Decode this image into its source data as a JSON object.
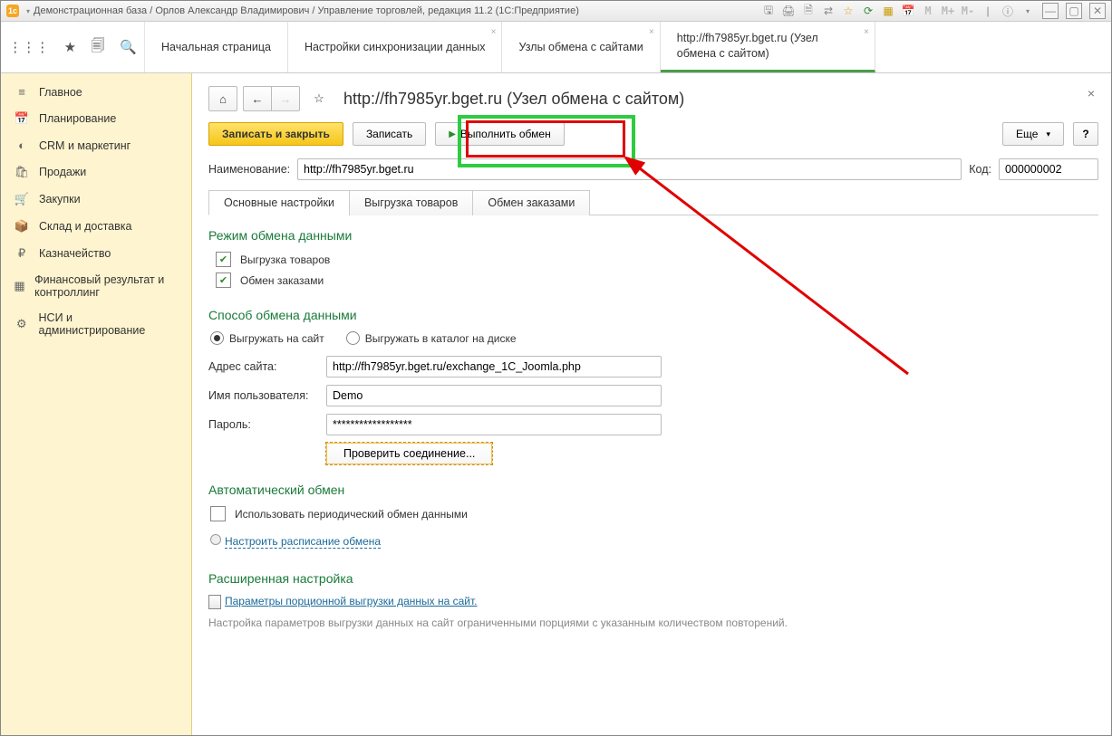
{
  "titlebar": {
    "logo_text": "1c",
    "title": "Демонстрационная база / Орлов Александр Владимирович / Управление торговлей, редакция 11.2  (1С:Предприятие)"
  },
  "tb_icons": {
    "m1": "M",
    "m2": "M+",
    "m3": "M-",
    "info": "ⓘ"
  },
  "tabs": [
    {
      "label": "Начальная страница",
      "active": false,
      "closable": false
    },
    {
      "label": "Настройки синхронизации данных",
      "active": false,
      "closable": true
    },
    {
      "label": "Узлы обмена с сайтами",
      "active": false,
      "closable": true
    },
    {
      "label": "http://fh7985yr.bget.ru (Узел обмена с сайтом)",
      "active": true,
      "closable": true
    }
  ],
  "sidebar": [
    {
      "icon": "≡",
      "label": "Главное"
    },
    {
      "icon": "📅",
      "label": "Планирование"
    },
    {
      "icon": "◐",
      "label": "CRM и маркетинг"
    },
    {
      "icon": "🛍",
      "label": "Продажи"
    },
    {
      "icon": "🛒",
      "label": "Закупки"
    },
    {
      "icon": "📦",
      "label": "Склад и доставка"
    },
    {
      "icon": "₽",
      "label": "Казначейство"
    },
    {
      "icon": "▦",
      "label": "Финансовый результат и контроллинг"
    },
    {
      "icon": "⚙",
      "label": "НСИ и администрирование"
    }
  ],
  "page": {
    "title": "http://fh7985yr.bget.ru (Узел обмена с сайтом)",
    "save_close": "Записать и закрыть",
    "save": "Записать",
    "exchange": "Выполнить обмен",
    "more": "Еще",
    "help": "?"
  },
  "name_field": {
    "label": "Наименование:",
    "value": "http://fh7985yr.bget.ru"
  },
  "code_field": {
    "label": "Код:",
    "value": "000000002"
  },
  "form_tabs": [
    "Основные настройки",
    "Выгрузка товаров",
    "Обмен заказами"
  ],
  "sections": {
    "mode": {
      "title": "Режим обмена данными",
      "chk1": "Выгрузка товаров",
      "chk2": "Обмен заказами"
    },
    "method": {
      "title": "Способ обмена данными",
      "r1": "Выгружать на сайт",
      "r2": "Выгружать в каталог на диске",
      "addr_label": "Адрес сайта:",
      "addr_value": "http://fh7985yr.bget.ru/exchange_1C_Joomla.php",
      "user_label": "Имя пользователя:",
      "user_value": "Demo",
      "pass_label": "Пароль:",
      "pass_value": "******************",
      "check_btn": "Проверить соединение..."
    },
    "auto": {
      "title": "Автоматический обмен",
      "chk": "Использовать периодический обмен данными",
      "sched": "Настроить расписание обмена"
    },
    "adv": {
      "title": "Расширенная настройка",
      "link": "Параметры порционной выгрузки данных на сайт.",
      "note": "Настройка параметров выгрузки данных на сайт ограниченными порциями с указанным количеством повторений."
    }
  }
}
